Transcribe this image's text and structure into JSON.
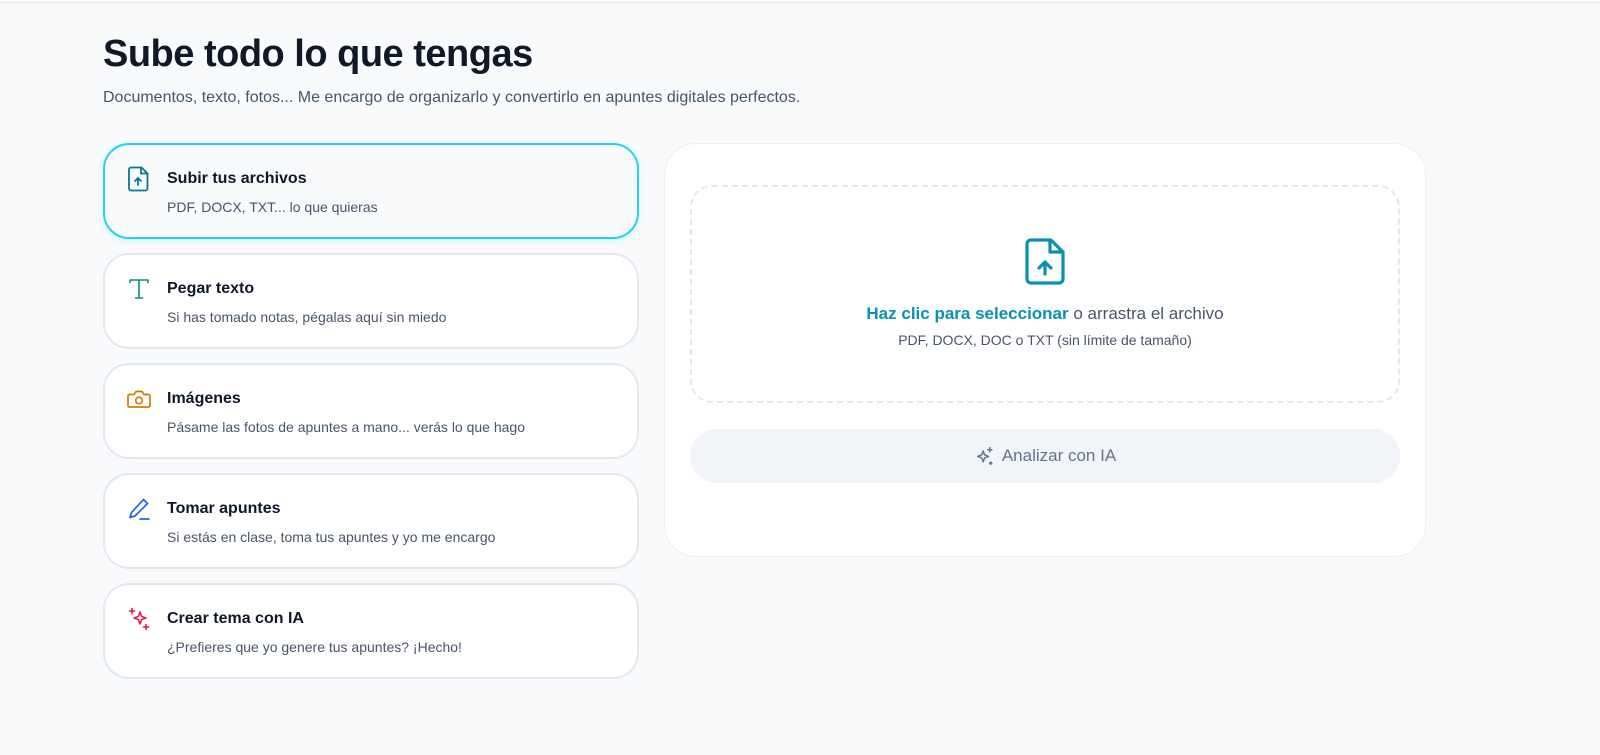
{
  "header": {
    "title": "Sube todo lo que tengas",
    "subtitle": "Documentos, texto, fotos... Me encargo de organizarlo y convertirlo en apuntes digitales perfectos."
  },
  "options": [
    {
      "id": "upload",
      "icon": "file-upload-icon",
      "title": "Subir tus archivos",
      "description": "PDF, DOCX, TXT... lo que quieras",
      "color": "#0e7490",
      "active": true
    },
    {
      "id": "paste",
      "icon": "text-type-icon",
      "title": "Pegar texto",
      "description": "Si has tomado notas, pégalas aquí sin miedo",
      "color": "#059669",
      "active": false
    },
    {
      "id": "images",
      "icon": "camera-icon",
      "title": "Imágenes",
      "description": "Pásame las fotos de apuntes a mano... verás lo que hago",
      "color": "#d97706",
      "active": false
    },
    {
      "id": "notes",
      "icon": "pen-icon",
      "title": "Tomar apuntes",
      "description": "Si estás en clase, toma tus apuntes y yo me encargo",
      "color": "#2563eb",
      "active": false
    },
    {
      "id": "ai",
      "icon": "sparkles-icon",
      "title": "Crear tema con IA",
      "description": "¿Prefieres que yo genere tus apuntes? ¡Hecho!",
      "color": "#e11d48",
      "active": false
    }
  ],
  "dropzone": {
    "icon": "file-upload-icon",
    "link_text": "Haz clic para seleccionar",
    "rest_text": " o arrastra el archivo",
    "hint": "PDF, DOCX, DOC o TXT (sin límite de tamaño)"
  },
  "analyze_button": {
    "icon": "sparkles-icon",
    "label": "Analizar con IA"
  },
  "colors": {
    "accent": "#0891b2",
    "active_border": "#22d3ee",
    "background": "#f8fafc"
  }
}
